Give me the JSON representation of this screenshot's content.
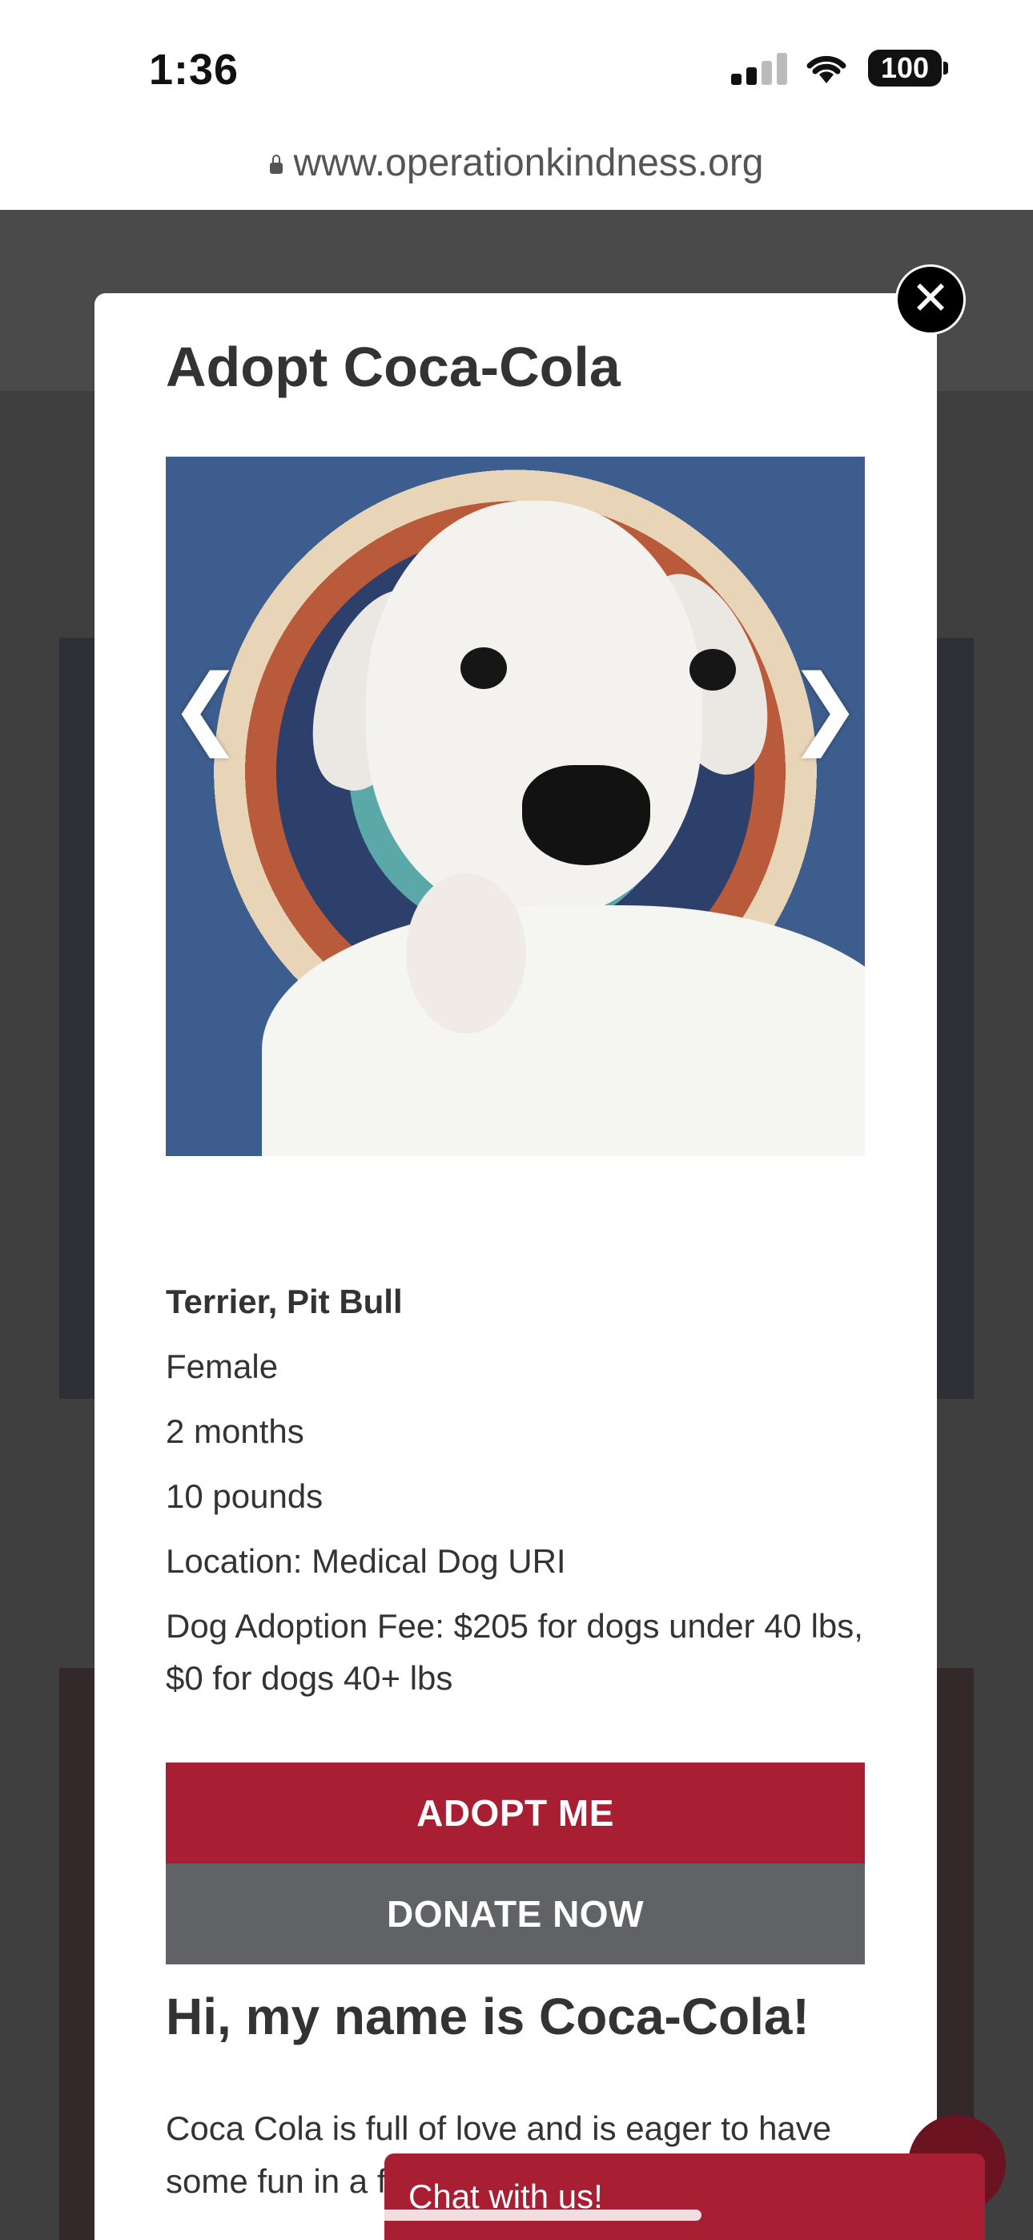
{
  "status_bar": {
    "time": "1:36",
    "battery": "100"
  },
  "browser": {
    "url": "www.operationkindness.org"
  },
  "modal": {
    "title": "Adopt Coca-Cola",
    "close_symbol": "✕",
    "gallery": {
      "prev_symbol": "❮",
      "next_symbol": "❯"
    },
    "details": {
      "breed": "Terrier, Pit Bull",
      "sex": "Female",
      "age": "2 months",
      "weight": "10 pounds",
      "location": "Location: Medical Dog URI",
      "fee": "Dog Adoption Fee: $205 for dogs under 40 lbs, $0 for dogs 40+ lbs"
    },
    "adopt_label": "ADOPT ME",
    "donate_label": "DONATE NOW",
    "greeting": "Hi, my name is Coca-Cola!",
    "bio": "Coca Cola is full of love and is eager to have some fun in a f"
  },
  "chat": {
    "label": "Chat with us!"
  },
  "colors": {
    "brand_red": "#a81e32",
    "donate_gray": "#616265",
    "overlay": "#444444"
  },
  "icons": [
    "signal-icon",
    "wifi-icon",
    "battery-icon",
    "lock-icon",
    "close-icon",
    "chevron-left-icon",
    "chevron-right-icon"
  ]
}
